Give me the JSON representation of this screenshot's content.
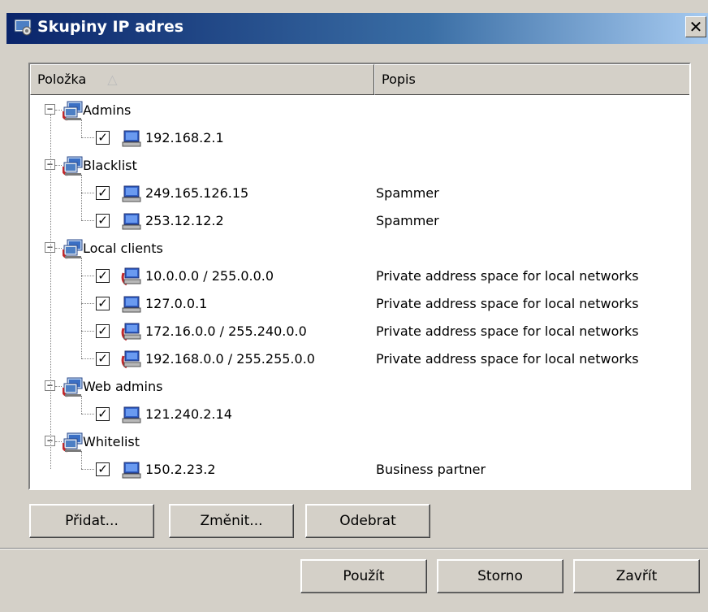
{
  "window": {
    "title": "Skupiny IP adres",
    "close_label": "✕"
  },
  "columns": {
    "item": "Položka",
    "item_sort": "△",
    "desc": "Popis"
  },
  "groups": [
    {
      "name": "Admins",
      "entries": [
        {
          "address": "192.168.2.1",
          "desc": "",
          "checked": true,
          "type": "host"
        }
      ]
    },
    {
      "name": "Blacklist",
      "entries": [
        {
          "address": "249.165.126.15",
          "desc": "Spammer",
          "checked": true,
          "type": "host"
        },
        {
          "address": "253.12.12.2",
          "desc": "Spammer",
          "checked": true,
          "type": "host"
        }
      ]
    },
    {
      "name": "Local clients",
      "entries": [
        {
          "address": "10.0.0.0 / 255.0.0.0",
          "desc": "Private address space for local networks",
          "checked": true,
          "type": "network"
        },
        {
          "address": "127.0.0.1",
          "desc": "Private address space for local networks",
          "checked": true,
          "type": "host"
        },
        {
          "address": "172.16.0.0 / 255.240.0.0",
          "desc": "Private address space for local networks",
          "checked": true,
          "type": "network"
        },
        {
          "address": "192.168.0.0 / 255.255.0.0",
          "desc": "Private address space for local networks",
          "checked": true,
          "type": "network"
        }
      ]
    },
    {
      "name": "Web admins",
      "entries": [
        {
          "address": "121.240.2.14",
          "desc": "",
          "checked": true,
          "type": "host"
        }
      ]
    },
    {
      "name": "Whitelist",
      "entries": [
        {
          "address": "150.2.23.2",
          "desc": "Business partner",
          "checked": true,
          "type": "host"
        }
      ]
    }
  ],
  "buttons": {
    "add": "Přidat...",
    "edit": "Změnit...",
    "remove": "Odebrat",
    "apply": "Použít",
    "cancel": "Storno",
    "close": "Zavřít"
  },
  "colors": {
    "titlebar_start": "#0a246a",
    "titlebar_end": "#a6caf0",
    "face": "#d4d0c8"
  }
}
